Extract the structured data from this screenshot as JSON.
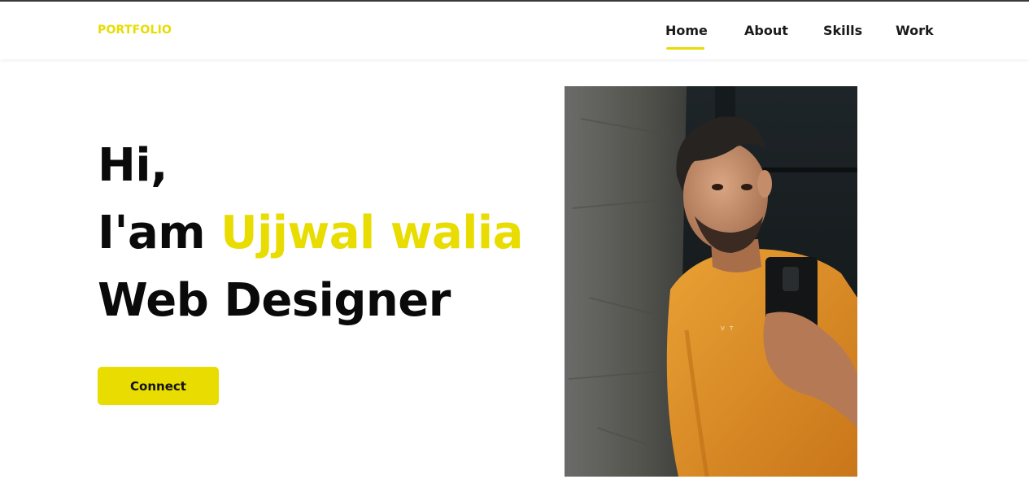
{
  "colors": {
    "accent": "#E8DC00",
    "text": "#0a0a0a",
    "shirt": "#E3921C"
  },
  "header": {
    "logo": "PORTFOLIO",
    "nav": [
      {
        "label": "Home",
        "active": true
      },
      {
        "label": "About"
      },
      {
        "label": "Skills"
      },
      {
        "label": "Work"
      }
    ]
  },
  "hero": {
    "greeting": "Hi,",
    "intro": "I'am ",
    "name": "Ujjwal walia",
    "role": "Web Designer",
    "button": "Connect"
  }
}
